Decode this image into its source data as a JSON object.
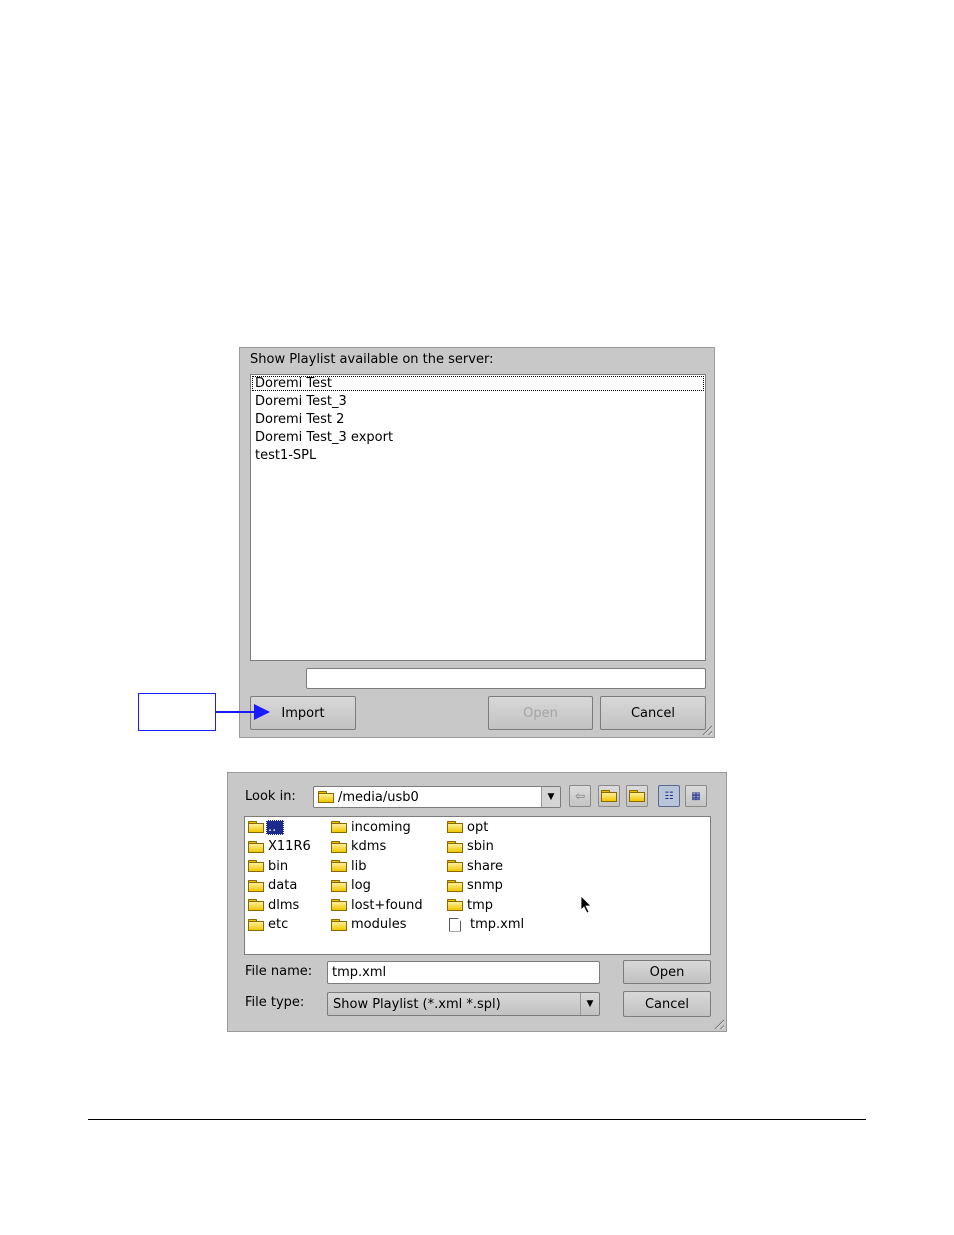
{
  "import_dialog": {
    "label": "Show Playlist available on the server:",
    "playlists": [
      "Doremi Test",
      "Doremi Test_3",
      "Doremi Test 2",
      "Doremi Test_3 export",
      "test1-SPL"
    ],
    "selected_index": 0,
    "import_label": "Import",
    "open_label": "Open",
    "cancel_label": "Cancel"
  },
  "file_dialog": {
    "look_in_label": "Look in:",
    "look_in_value": "/media/usb0",
    "files": [
      {
        "name": "..",
        "type": "folder",
        "selected": true
      },
      {
        "name": "X11R6",
        "type": "folder"
      },
      {
        "name": "bin",
        "type": "folder"
      },
      {
        "name": "data",
        "type": "folder"
      },
      {
        "name": "dlms",
        "type": "folder"
      },
      {
        "name": "etc",
        "type": "folder"
      },
      {
        "name": "incoming",
        "type": "folder"
      },
      {
        "name": "kdms",
        "type": "folder"
      },
      {
        "name": "lib",
        "type": "folder"
      },
      {
        "name": "log",
        "type": "folder"
      },
      {
        "name": "lost+found",
        "type": "folder"
      },
      {
        "name": "modules",
        "type": "folder"
      },
      {
        "name": "opt",
        "type": "folder"
      },
      {
        "name": "sbin",
        "type": "folder"
      },
      {
        "name": "share",
        "type": "folder"
      },
      {
        "name": "snmp",
        "type": "folder"
      },
      {
        "name": "tmp",
        "type": "folder"
      },
      {
        "name": "tmp.xml",
        "type": "file"
      }
    ],
    "file_name_label": "File name:",
    "file_name_value": "tmp.xml",
    "file_type_label": "File type:",
    "file_type_value": "Show Playlist (*.xml *.spl)",
    "open_label": "Open",
    "cancel_label": "Cancel"
  }
}
